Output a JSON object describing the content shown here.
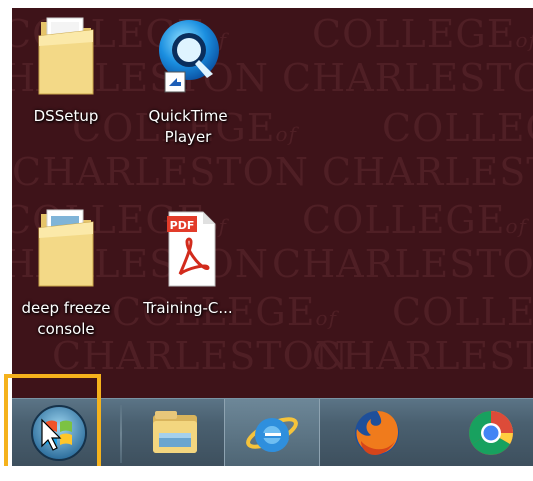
{
  "wallpaper": {
    "watermark_line1": "COLLEGE",
    "watermark_of": "of",
    "watermark_line2": "CHARLESTON"
  },
  "desktop_icons": [
    {
      "label": "DSSetup"
    },
    {
      "label": "QuickTime\nPlayer"
    },
    {
      "label": "deep freeze\nconsole"
    },
    {
      "label": "Training-C..."
    }
  ],
  "pdf_icon_text": "PDF",
  "taskbar": {
    "items": [
      {
        "icon": "windows-start-orb"
      },
      {
        "icon": "file-explorer-icon"
      },
      {
        "icon": "internet-explorer-icon"
      },
      {
        "icon": "firefox-icon"
      },
      {
        "icon": "chrome-icon"
      }
    ]
  },
  "colors": {
    "wallpaper": "#3e1319",
    "highlight": "#f5b21c"
  }
}
